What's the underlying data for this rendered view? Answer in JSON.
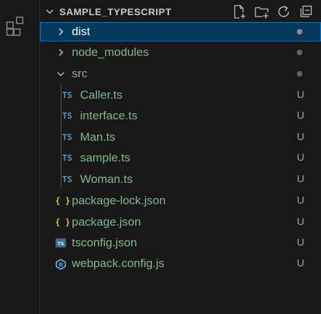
{
  "explorer": {
    "title": "SAMPLE_TYPESCRIPT",
    "actions": [
      "new-file-icon",
      "new-folder-icon",
      "refresh-icon",
      "collapse-all-icon"
    ]
  },
  "colors": {
    "background": "#181818",
    "selected_row": "#04395e",
    "selected_border": "#0078d4",
    "git_untracked": "#81b88b",
    "ts_icon": "#519aba",
    "json_icon": "#cbcb41"
  },
  "tree": {
    "dist": {
      "label": "dist",
      "decoration": "dot",
      "dot_color": "#8c8c8c"
    },
    "node_modules": {
      "label": "node_modules",
      "decoration": "dot",
      "dot_color": "#4f6d57"
    },
    "src": {
      "label": "src",
      "decoration": "dot",
      "dot_color": "#4f6d57"
    },
    "caller": {
      "icon": "TS",
      "label": "Caller.ts",
      "status": "U"
    },
    "interface": {
      "icon": "TS",
      "label": "interface.ts",
      "status": "U"
    },
    "man": {
      "icon": "TS",
      "label": "Man.ts",
      "status": "U"
    },
    "sample": {
      "icon": "TS",
      "label": "sample.ts",
      "status": "U"
    },
    "woman": {
      "icon": "TS",
      "label": "Woman.ts",
      "status": "U"
    },
    "package_lock": {
      "icon": "{ }",
      "label": "package-lock.json",
      "status": "U"
    },
    "package": {
      "icon": "{ }",
      "label": "package.json",
      "status": "U"
    },
    "tsconfig": {
      "icon": "tsconfig-icon",
      "label": "tsconfig.json",
      "status": "U"
    },
    "webpack": {
      "icon": "webpack-icon",
      "label": "webpack.config.js",
      "status": "U"
    }
  }
}
